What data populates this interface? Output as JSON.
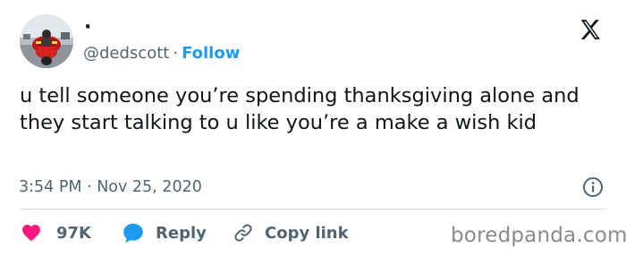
{
  "author": {
    "display_name": "·",
    "handle": "@dedscott",
    "separator": "·",
    "follow_label": "Follow",
    "avatar_icon": "motorcycle-rider-avatar"
  },
  "platform": {
    "logo_icon": "x-logo-icon"
  },
  "tweet": {
    "text": "u tell someone you’re spending thanksgiving alone and they start talking to u like you’re a make a wish kid",
    "timestamp": "3:54 PM · Nov 25, 2020",
    "info_icon": "info-icon"
  },
  "actions": {
    "like": {
      "icon": "heart-icon",
      "label": "97K",
      "color": "#f91880"
    },
    "reply": {
      "icon": "speech-bubble-icon",
      "label": "Reply",
      "color": "#1d9bf0"
    },
    "copy": {
      "icon": "link-icon",
      "label": "Copy link",
      "color": "#536471"
    }
  },
  "watermark": "boredpanda.com",
  "colors": {
    "accent": "#1d9bf0",
    "text": "#0f1419",
    "muted": "#536471",
    "like": "#f91880"
  }
}
